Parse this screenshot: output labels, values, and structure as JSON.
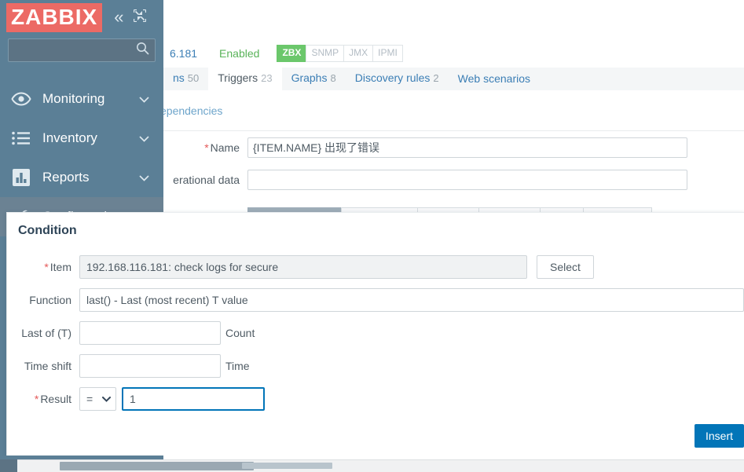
{
  "sidebar": {
    "logo_text": "ZABBIX",
    "logo_bg": "#ec6a65",
    "collapse_icon": "chevron-double-left-icon",
    "fullscreen_icon": "fullscreen-icon",
    "search": {
      "value": "",
      "placeholder": ""
    },
    "items": [
      {
        "label": "Monitoring",
        "icon": "eye-icon",
        "active": false,
        "chevron": "chevron-down-icon"
      },
      {
        "label": "Inventory",
        "icon": "list-icon",
        "active": false,
        "chevron": "chevron-down-icon"
      },
      {
        "label": "Reports",
        "icon": "bar-chart-icon",
        "active": false,
        "chevron": "chevron-down-icon"
      },
      {
        "label": "Configuration",
        "icon": "wrench-icon",
        "active": true,
        "chevron": "chevron-up-icon"
      }
    ]
  },
  "host_strip": {
    "ip": "6.181",
    "status": "Enabled",
    "interfaces": [
      {
        "label": "ZBX",
        "enabled": true
      },
      {
        "label": "SNMP",
        "enabled": false
      },
      {
        "label": "JMX",
        "enabled": false
      },
      {
        "label": "IPMI",
        "enabled": false
      }
    ]
  },
  "tabs": [
    {
      "label": "ns",
      "count": "50",
      "active": false
    },
    {
      "label": "Triggers",
      "count": "23",
      "active": true
    },
    {
      "label": "Graphs",
      "count": "8",
      "active": false
    },
    {
      "label": "Discovery rules",
      "count": "2",
      "active": false
    },
    {
      "label": "Web scenarios",
      "count": "",
      "active": false
    }
  ],
  "subtab": {
    "label": "ependencies"
  },
  "background_form": {
    "name_label": "Name",
    "name_value": "{ITEM.NAME} 出现了错误",
    "opdata_label": "erational data",
    "opdata_value": ""
  },
  "modal": {
    "title": "Condition",
    "item": {
      "label": "Item",
      "required": true,
      "value": "192.168.116.181: check logs for secure",
      "select_button": "Select"
    },
    "function": {
      "label": "Function",
      "required": false,
      "value": "last() - Last (most recent) T value"
    },
    "last_of_t": {
      "label": "Last of (T)",
      "required": false,
      "value": "",
      "unit": "Count"
    },
    "time_shift": {
      "label": "Time shift",
      "required": false,
      "value": "",
      "unit": "Time"
    },
    "result": {
      "label": "Result",
      "required": true,
      "operator": "=",
      "value": "1"
    },
    "insert_button": "Insert",
    "primary_color": "#0275b8"
  },
  "colors": {
    "sidebar_bg": "#5b7f96",
    "accent_blue": "#0275b8",
    "link_blue": "#3b7eb5",
    "green": "#6bc76b",
    "required_red": "#e45959"
  }
}
